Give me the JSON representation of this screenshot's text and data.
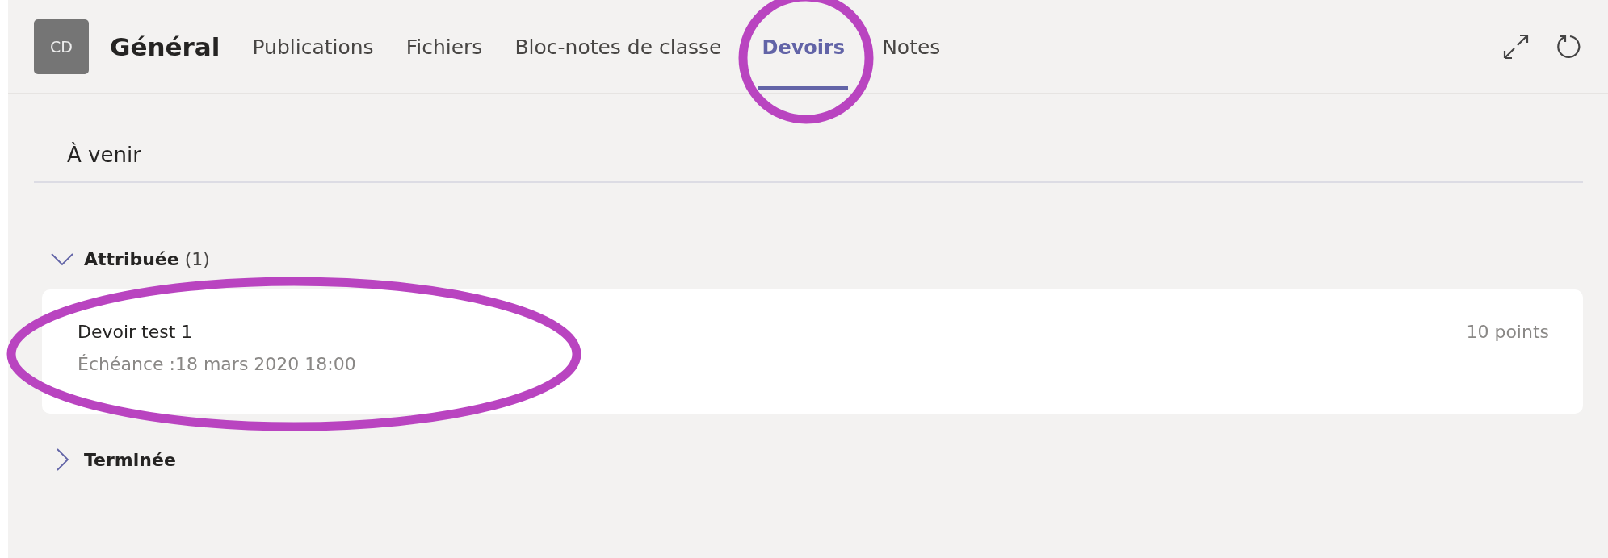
{
  "header": {
    "avatar": "CD",
    "title": "Général",
    "tabs": [
      {
        "label": "Publications",
        "selected": false
      },
      {
        "label": "Fichiers",
        "selected": false
      },
      {
        "label": "Bloc-notes de classe",
        "selected": false
      },
      {
        "label": "Devoirs",
        "selected": true
      },
      {
        "label": "Notes",
        "selected": false
      }
    ]
  },
  "section_title": "À venir",
  "groups": [
    {
      "label": "Attribuée",
      "count": "(1)",
      "expanded": true,
      "assignments": [
        {
          "title": "Devoir test 1",
          "due": "Échéance :18 mars 2020 18:00",
          "points": "10 points"
        }
      ]
    },
    {
      "label": "Terminée",
      "expanded": false
    }
  ],
  "annotations": [
    {
      "color": "#b944c0"
    },
    {
      "color": "#b944c0"
    }
  ]
}
